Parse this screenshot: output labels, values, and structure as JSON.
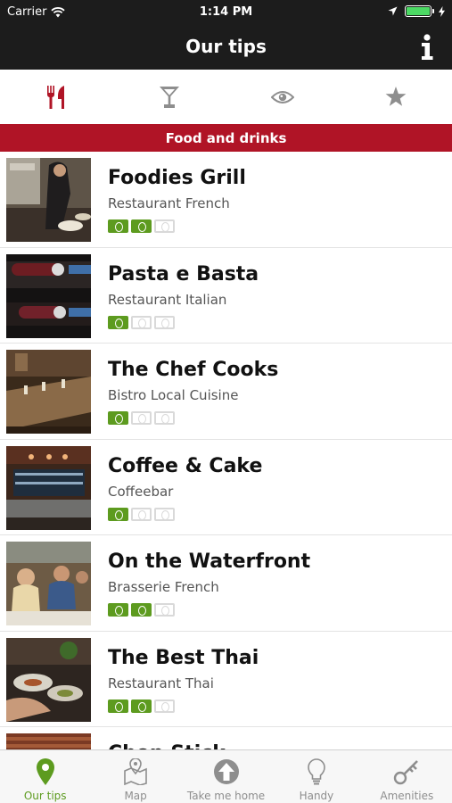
{
  "status_bar": {
    "carrier": "Carrier",
    "time": "1:14 PM"
  },
  "nav": {
    "title": "Our tips",
    "info_icon": "info-icon"
  },
  "category_tabs": [
    {
      "icon": "fork-knife-icon",
      "active": true
    },
    {
      "icon": "cocktail-glass-icon",
      "active": false
    },
    {
      "icon": "eye-icon",
      "active": false
    },
    {
      "icon": "star-icon",
      "active": false
    }
  ],
  "section_title": "Food and drinks",
  "colors": {
    "accent_red": "#b01426",
    "price_green": "#5d9b1f",
    "inactive_gray": "#8e8e8e",
    "bar_dark": "#1c1c1c"
  },
  "venues": [
    {
      "name": "Foodies Grill",
      "type": "Restaurant French",
      "price_level": 2,
      "price_max": 3
    },
    {
      "name": "Pasta e Basta",
      "type": "Restaurant Italian",
      "price_level": 1,
      "price_max": 3
    },
    {
      "name": "The Chef Cooks",
      "type": "Bistro Local Cuisine",
      "price_level": 1,
      "price_max": 3
    },
    {
      "name": "Coffee & Cake",
      "type": "Coffeebar",
      "price_level": 1,
      "price_max": 3
    },
    {
      "name": "On the Waterfront",
      "type": "Brasserie French",
      "price_level": 2,
      "price_max": 3
    },
    {
      "name": "The Best Thai",
      "type": "Restaurant Thai",
      "price_level": 2,
      "price_max": 3
    },
    {
      "name": "Chop Stick",
      "type": "",
      "price_level": 0,
      "price_max": 0
    }
  ],
  "tab_bar": [
    {
      "label": "Our tips",
      "icon": "map-pin-icon",
      "active": true
    },
    {
      "label": "Map",
      "icon": "map-icon",
      "active": false
    },
    {
      "label": "Take me home",
      "icon": "home-arrow-icon",
      "active": false
    },
    {
      "label": "Handy",
      "icon": "lightbulb-icon",
      "active": false
    },
    {
      "label": "Amenities",
      "icon": "key-icon",
      "active": false
    }
  ]
}
